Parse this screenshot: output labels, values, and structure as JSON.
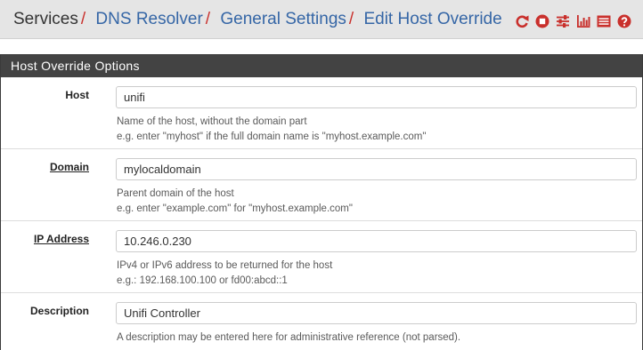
{
  "breadcrumb": {
    "items": [
      "Services",
      "DNS Resolver",
      "General Settings",
      "Edit Host Override"
    ],
    "separator": "/"
  },
  "toolbar_icons": [
    "restart-service-icon",
    "stop-service-icon",
    "settings-sliders-icon",
    "status-chart-icon",
    "log-icon",
    "help-icon"
  ],
  "colors": {
    "accent_red": "#c9302c",
    "link_blue": "#3566a6",
    "panel_header": "#434343"
  },
  "panel": {
    "title": "Host Override Options",
    "rows": [
      {
        "label": "Host",
        "value": "unifi",
        "help": [
          "Name of the host, without the domain part",
          "e.g. enter \"myhost\" if the full domain name is \"myhost.example.com\""
        ]
      },
      {
        "label": "Domain",
        "value": "mylocaldomain",
        "help": [
          "Parent domain of the host",
          "e.g. enter \"example.com\" for \"myhost.example.com\""
        ]
      },
      {
        "label": "IP Address",
        "value": "10.246.0.230",
        "help": [
          "IPv4 or IPv6 address to be returned for the host",
          "e.g.: 192.168.100.100 or fd00:abcd::1"
        ]
      },
      {
        "label": "Description",
        "value": "Unifi Controller",
        "help": [
          "A description may be entered here for administrative reference (not parsed)."
        ]
      }
    ]
  }
}
